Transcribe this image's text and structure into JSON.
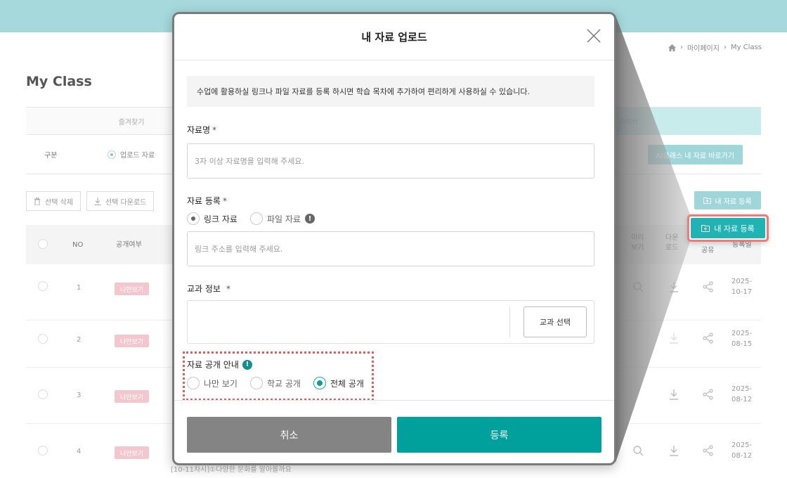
{
  "background": {
    "breadcrumb": [
      "마이페이지",
      "My Class"
    ],
    "page_title": "My Class",
    "tabs": {
      "favorites": "즐겨찾기",
      "ai_partial": "라이브"
    },
    "filter": {
      "label": "구분",
      "option": "업로드 자료",
      "ai_button": "AI클래스 내 자료 바로가기"
    },
    "buttons": {
      "delete": "선택 삭제",
      "download": "선택 다운로드",
      "register": "내 자료 등록"
    },
    "table": {
      "headers": {
        "no": "NO",
        "visibility": "공개여부",
        "preview": "미리\n보기",
        "download": "다운\n로드",
        "share": "공유",
        "date": "등록일"
      },
      "rows": [
        {
          "no": "1",
          "badge": "나만보기",
          "date": "2025-\n10-17"
        },
        {
          "no": "2",
          "badge": "나만보기",
          "date": "2025-\n08-15"
        },
        {
          "no": "3",
          "badge": "나만보기",
          "date": "2025-\n08-12"
        },
        {
          "no": "4",
          "badge": "나만보기",
          "date": "2025-\n08-12"
        }
      ]
    },
    "bottom_text": "[10-11차시]①다양한 문화를 알아볼까요"
  },
  "highlight_button": {
    "label": "내 자료 등록"
  },
  "modal": {
    "title": "내 자료 업로드",
    "info": "수업에 활용하실 링크나 파일 자료를 등록 하시면 학습 목차에 추가하여 편리하게 사용하실 수 있습니다.",
    "name": {
      "label": "자료명",
      "required": "*",
      "placeholder": "3자 이상 자료명을 입력해 주세요."
    },
    "register": {
      "label": "자료 등록",
      "required": "*",
      "options": [
        "링크 자료",
        "파일 자료"
      ],
      "selected": "링크 자료",
      "placeholder": "링크 주소를 입력해 주세요."
    },
    "subject": {
      "label": "교과 정보",
      "required": "*",
      "button": "교과 선택"
    },
    "public": {
      "label": "자료 공개 안내",
      "options": [
        "나만 보기",
        "학교 공개",
        "전체 공개"
      ],
      "selected": "전체 공개"
    },
    "cancel": "취소",
    "submit": "등록",
    "info_icon_glyph": "!"
  },
  "colors": {
    "teal": "#00a09d",
    "topbar": "#a5d9dc",
    "highlight": "#f07a7a",
    "cancel": "#848484"
  }
}
